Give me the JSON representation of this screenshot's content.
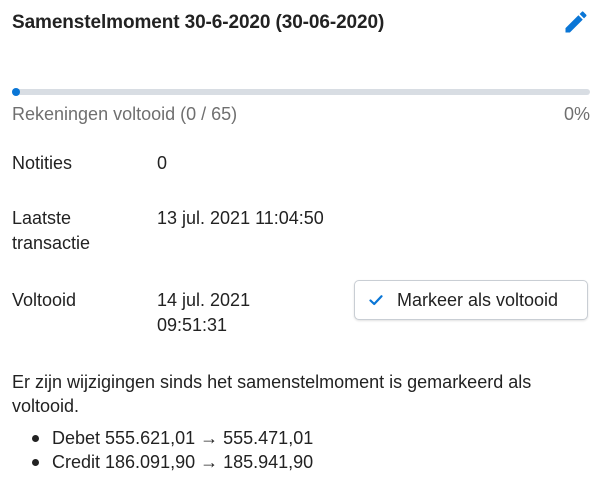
{
  "header": {
    "title": "Samenstelmoment 30-6-2020 (30-06-2020)",
    "edit_icon": "pencil-icon",
    "accent_color": "#0a76d6"
  },
  "progress": {
    "label": "Rekeningen voltooid (0 / 65)",
    "percent_text": "0%",
    "completed": 0,
    "total": 65,
    "fraction": 0.0
  },
  "details": {
    "notes_label": "Notities",
    "notes_value": "0",
    "last_transaction_label_line1": "Laatste",
    "last_transaction_label_line2": "transactie",
    "last_transaction_value": "13 jul. 2021 11:04:50",
    "completed_label": "Voltooid",
    "completed_value_line1": "14 jul. 2021",
    "completed_value_line2": "09:51:31"
  },
  "actions": {
    "mark_complete_label": "Markeer als voltooid",
    "mark_complete_icon": "checkmark-icon"
  },
  "message": {
    "text": "Er zijn wijzigingen sinds het samenstelmoment is gemarkeerd als voltooid.",
    "changes": [
      "Debet 555.621,01 → 555.471,01",
      "Credit 186.091,90 → 185.941,90"
    ]
  }
}
